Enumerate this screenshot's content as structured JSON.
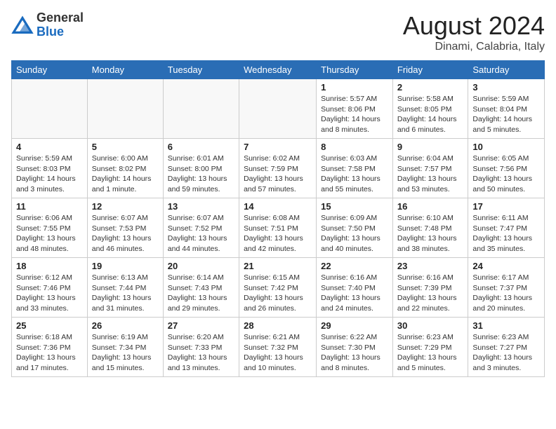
{
  "header": {
    "logo_general": "General",
    "logo_blue": "Blue",
    "month": "August 2024",
    "location": "Dinami, Calabria, Italy"
  },
  "weekdays": [
    "Sunday",
    "Monday",
    "Tuesday",
    "Wednesday",
    "Thursday",
    "Friday",
    "Saturday"
  ],
  "weeks": [
    [
      {
        "day": "",
        "info": ""
      },
      {
        "day": "",
        "info": ""
      },
      {
        "day": "",
        "info": ""
      },
      {
        "day": "",
        "info": ""
      },
      {
        "day": "1",
        "info": "Sunrise: 5:57 AM\nSunset: 8:06 PM\nDaylight: 14 hours\nand 8 minutes."
      },
      {
        "day": "2",
        "info": "Sunrise: 5:58 AM\nSunset: 8:05 PM\nDaylight: 14 hours\nand 6 minutes."
      },
      {
        "day": "3",
        "info": "Sunrise: 5:59 AM\nSunset: 8:04 PM\nDaylight: 14 hours\nand 5 minutes."
      }
    ],
    [
      {
        "day": "4",
        "info": "Sunrise: 5:59 AM\nSunset: 8:03 PM\nDaylight: 14 hours\nand 3 minutes."
      },
      {
        "day": "5",
        "info": "Sunrise: 6:00 AM\nSunset: 8:02 PM\nDaylight: 14 hours\nand 1 minute."
      },
      {
        "day": "6",
        "info": "Sunrise: 6:01 AM\nSunset: 8:00 PM\nDaylight: 13 hours\nand 59 minutes."
      },
      {
        "day": "7",
        "info": "Sunrise: 6:02 AM\nSunset: 7:59 PM\nDaylight: 13 hours\nand 57 minutes."
      },
      {
        "day": "8",
        "info": "Sunrise: 6:03 AM\nSunset: 7:58 PM\nDaylight: 13 hours\nand 55 minutes."
      },
      {
        "day": "9",
        "info": "Sunrise: 6:04 AM\nSunset: 7:57 PM\nDaylight: 13 hours\nand 53 minutes."
      },
      {
        "day": "10",
        "info": "Sunrise: 6:05 AM\nSunset: 7:56 PM\nDaylight: 13 hours\nand 50 minutes."
      }
    ],
    [
      {
        "day": "11",
        "info": "Sunrise: 6:06 AM\nSunset: 7:55 PM\nDaylight: 13 hours\nand 48 minutes."
      },
      {
        "day": "12",
        "info": "Sunrise: 6:07 AM\nSunset: 7:53 PM\nDaylight: 13 hours\nand 46 minutes."
      },
      {
        "day": "13",
        "info": "Sunrise: 6:07 AM\nSunset: 7:52 PM\nDaylight: 13 hours\nand 44 minutes."
      },
      {
        "day": "14",
        "info": "Sunrise: 6:08 AM\nSunset: 7:51 PM\nDaylight: 13 hours\nand 42 minutes."
      },
      {
        "day": "15",
        "info": "Sunrise: 6:09 AM\nSunset: 7:50 PM\nDaylight: 13 hours\nand 40 minutes."
      },
      {
        "day": "16",
        "info": "Sunrise: 6:10 AM\nSunset: 7:48 PM\nDaylight: 13 hours\nand 38 minutes."
      },
      {
        "day": "17",
        "info": "Sunrise: 6:11 AM\nSunset: 7:47 PM\nDaylight: 13 hours\nand 35 minutes."
      }
    ],
    [
      {
        "day": "18",
        "info": "Sunrise: 6:12 AM\nSunset: 7:46 PM\nDaylight: 13 hours\nand 33 minutes."
      },
      {
        "day": "19",
        "info": "Sunrise: 6:13 AM\nSunset: 7:44 PM\nDaylight: 13 hours\nand 31 minutes."
      },
      {
        "day": "20",
        "info": "Sunrise: 6:14 AM\nSunset: 7:43 PM\nDaylight: 13 hours\nand 29 minutes."
      },
      {
        "day": "21",
        "info": "Sunrise: 6:15 AM\nSunset: 7:42 PM\nDaylight: 13 hours\nand 26 minutes."
      },
      {
        "day": "22",
        "info": "Sunrise: 6:16 AM\nSunset: 7:40 PM\nDaylight: 13 hours\nand 24 minutes."
      },
      {
        "day": "23",
        "info": "Sunrise: 6:16 AM\nSunset: 7:39 PM\nDaylight: 13 hours\nand 22 minutes."
      },
      {
        "day": "24",
        "info": "Sunrise: 6:17 AM\nSunset: 7:37 PM\nDaylight: 13 hours\nand 20 minutes."
      }
    ],
    [
      {
        "day": "25",
        "info": "Sunrise: 6:18 AM\nSunset: 7:36 PM\nDaylight: 13 hours\nand 17 minutes."
      },
      {
        "day": "26",
        "info": "Sunrise: 6:19 AM\nSunset: 7:34 PM\nDaylight: 13 hours\nand 15 minutes."
      },
      {
        "day": "27",
        "info": "Sunrise: 6:20 AM\nSunset: 7:33 PM\nDaylight: 13 hours\nand 13 minutes."
      },
      {
        "day": "28",
        "info": "Sunrise: 6:21 AM\nSunset: 7:32 PM\nDaylight: 13 hours\nand 10 minutes."
      },
      {
        "day": "29",
        "info": "Sunrise: 6:22 AM\nSunset: 7:30 PM\nDaylight: 13 hours\nand 8 minutes."
      },
      {
        "day": "30",
        "info": "Sunrise: 6:23 AM\nSunset: 7:29 PM\nDaylight: 13 hours\nand 5 minutes."
      },
      {
        "day": "31",
        "info": "Sunrise: 6:23 AM\nSunset: 7:27 PM\nDaylight: 13 hours\nand 3 minutes."
      }
    ]
  ]
}
